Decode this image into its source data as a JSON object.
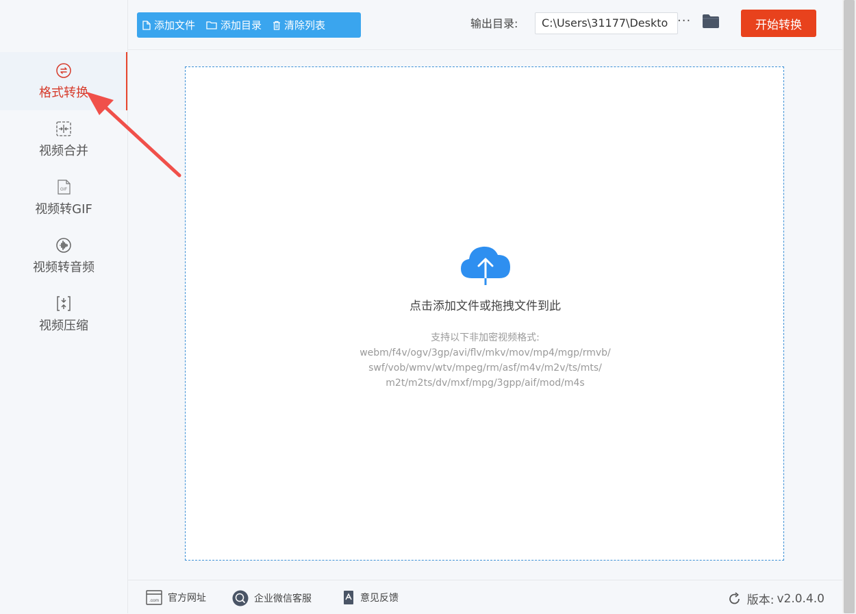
{
  "sidebar": {
    "items": [
      {
        "label": "格式转换",
        "icon": "format-convert-icon",
        "active": true
      },
      {
        "label": "视频合并",
        "icon": "merge-icon"
      },
      {
        "label": "视频转GIF",
        "icon": "gif-icon"
      },
      {
        "label": "视频转音频",
        "icon": "audio-wave-icon"
      },
      {
        "label": "视频压缩",
        "icon": "compress-icon"
      }
    ]
  },
  "toolbar": {
    "add_file": "添加文件",
    "add_dir": "添加目录",
    "clear_list": "清除列表",
    "output_label": "输出目录:",
    "output_path": "C:\\Users\\31177\\Deskto",
    "more": "···",
    "start": "开始转换"
  },
  "dropzone": {
    "title": "点击添加文件或拖拽文件到此",
    "formats_heading": "支持以下非加密视频格式:",
    "formats_lines": [
      "webm/f4v/ogv/3gp/avi/flv/mkv/mov/mp4/mgp/rmvb/",
      "swf/vob/wmv/wtv/mpeg/rm/asf/m4v/m2v/ts/mts/",
      "m2t/m2ts/dv/mxf/mpg/3gpp/aif/mod/m4s"
    ]
  },
  "footer": {
    "website": "官方网址",
    "wechat": "企业微信客服",
    "feedback": "意见反馈",
    "version_label": "版本:",
    "version_value": "v2.0.4.0",
    "website_icon_text": ".com"
  },
  "colors": {
    "accent_blue": "#3aa5ee",
    "start_red": "#e8421d",
    "active_red": "#d63a2a",
    "annotation_arrow": "#f0504a"
  }
}
